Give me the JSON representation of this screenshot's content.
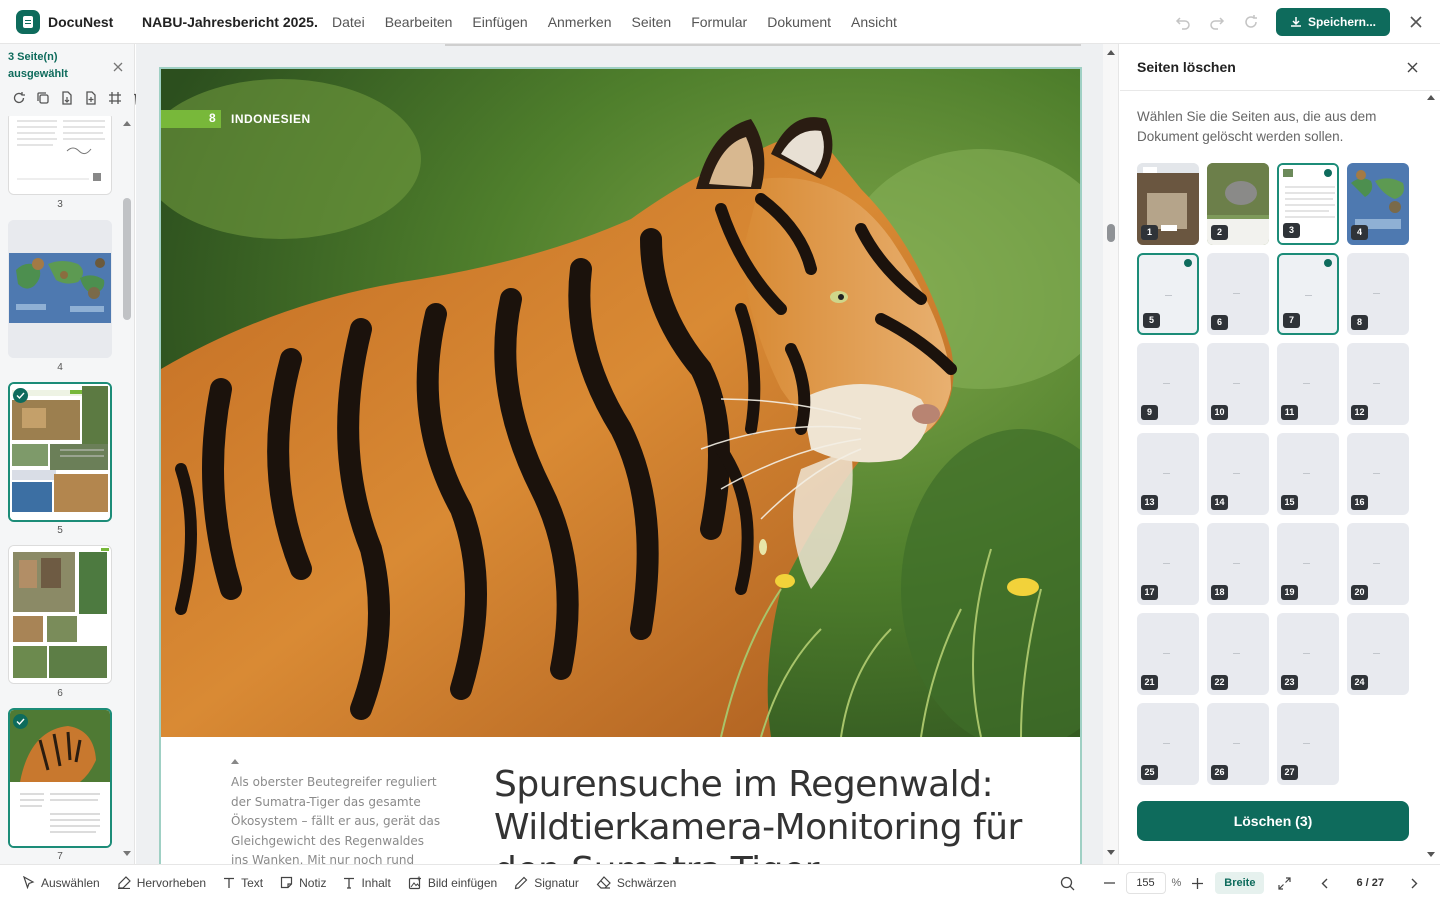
{
  "app": {
    "name": "DocuNest",
    "doc_title": "NABU-Jahresbericht 2025...."
  },
  "menu": [
    "Datei",
    "Bearbeiten",
    "Einfügen",
    "Anmerken",
    "Seiten",
    "Formular",
    "Dokument",
    "Ansicht"
  ],
  "toolbar": {
    "save_label": "Speichern..."
  },
  "sidebar": {
    "selection": "3 Seite(n) ausgewählt",
    "thumbs": [
      {
        "num": "3",
        "selected": false
      },
      {
        "num": "4",
        "selected": false
      },
      {
        "num": "5",
        "selected": true
      },
      {
        "num": "6",
        "selected": false
      },
      {
        "num": "7",
        "selected": true
      }
    ]
  },
  "document": {
    "section_number": "8",
    "section_label": "INDONESIEN",
    "caption": "Als oberster Beutegreifer reguliert der Sumatra-Tiger das gesamte Ökosystem – fällt er aus, gerät das Gleichgewicht des Regenwaldes ins Wanken. Mit nur noch rund",
    "headline": "Spurensuche im Regenwald: Wildtierkamera-Monitoring für den Sumatra-Tiger"
  },
  "panel": {
    "title": "Seiten löschen",
    "description": "Wählen Sie die Seiten aus, die aus dem Dokument gelöscht werden sollen.",
    "pages": [
      "1",
      "2",
      "3",
      "4",
      "5",
      "6",
      "7",
      "8",
      "9",
      "10",
      "11",
      "12",
      "13",
      "14",
      "15",
      "16",
      "17",
      "18",
      "19",
      "20",
      "21",
      "22",
      "23",
      "24",
      "25",
      "26",
      "27"
    ],
    "selected_pages": [
      "3",
      "5",
      "7"
    ],
    "delete_label": "Löschen (3)"
  },
  "bottom_tools": [
    "Auswählen",
    "Hervorheben",
    "Text",
    "Notiz",
    "Inhalt",
    "Bild einfügen",
    "Signatur",
    "Schwärzen"
  ],
  "zoom": {
    "value": "155",
    "unit": "%",
    "fit_label": "Breite"
  },
  "pagination": {
    "label": "6 / 27"
  },
  "colors": {
    "accent": "#0e6b5c",
    "section_green": "#78b83a",
    "selection_border": "#1c8c78"
  }
}
